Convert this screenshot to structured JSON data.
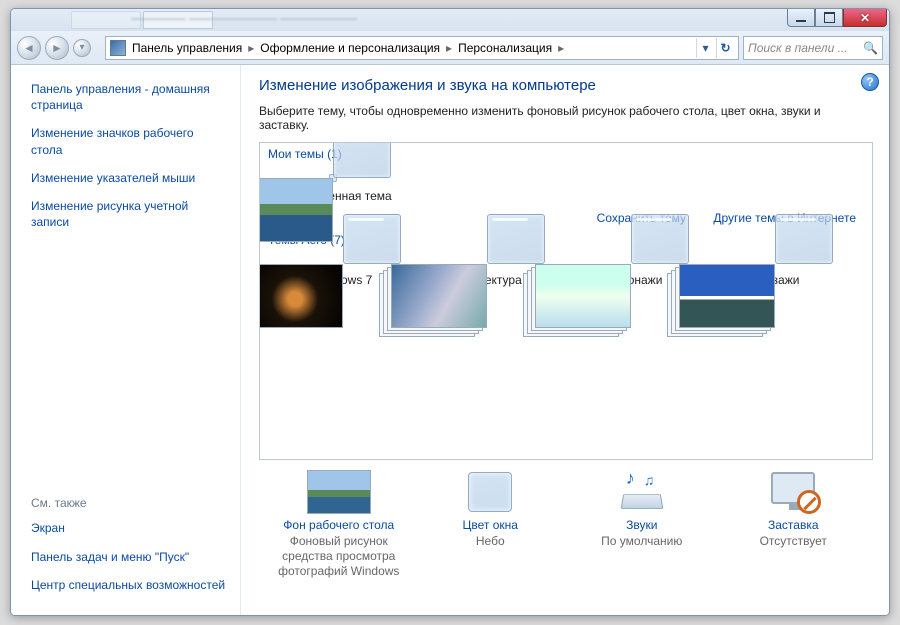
{
  "window_title_blur": "————— ————————  ———————",
  "breadcrumbs": [
    "Панель управления",
    "Оформление и персонализация",
    "Персонализация"
  ],
  "search_placeholder": "Поиск в панели ...",
  "sidebar": {
    "home": "Панель управления - домашняя страница",
    "links": [
      "Изменение значков рабочего стола",
      "Изменение указателей мыши",
      "Изменение рисунка учетной записи"
    ],
    "see_also_heading": "См. также",
    "see_also": [
      "Экран",
      "Панель задач и меню \"Пуск\"",
      "Центр специальных возможностей"
    ]
  },
  "page": {
    "title": "Изменение изображения и звука на компьютере",
    "desc": "Выберите тему, чтобы одновременно изменить фоновый рисунок рабочего стола, цвет окна, звуки и заставку."
  },
  "groups": {
    "my_themes_label": "Мои темы (1)",
    "my_theme_caption": "Несохраненная тема",
    "save_theme": "Сохранить тему",
    "more_online": "Другие темы в Интернете",
    "aero_label": "Темы Aero (7)",
    "aero": [
      "Windows 7",
      "Архитектура",
      "Персонажи",
      "Пейзажи"
    ]
  },
  "settings": {
    "wallpaper": {
      "title": "Фон рабочего стола",
      "value": "Фоновый рисунок средства просмотра фотографий Windows"
    },
    "color": {
      "title": "Цвет окна",
      "value": "Небо"
    },
    "sounds": {
      "title": "Звуки",
      "value": "По умолчанию"
    },
    "saver": {
      "title": "Заставка",
      "value": "Отсутствует"
    }
  }
}
